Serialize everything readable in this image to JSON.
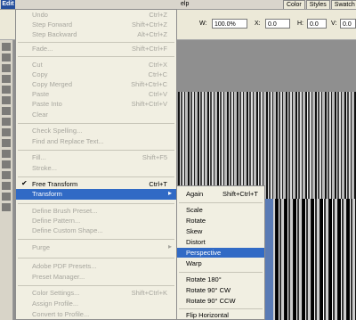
{
  "menubar": {
    "edit": "Edit",
    "help": "elp",
    "tabs": [
      "Color",
      "Styles",
      "Swatch"
    ]
  },
  "options": {
    "w_label": "W:",
    "w_value": "100.0%",
    "x_label": "X:",
    "x_value": "0.0",
    "h_label": "H:",
    "h_value": "0.0",
    "v_label": "V:",
    "v_value": "0.0"
  },
  "edit_menu": {
    "undo": {
      "label": "Undo",
      "shortcut": "Ctrl+Z"
    },
    "step_forward": {
      "label": "Step Forward",
      "shortcut": "Shift+Ctrl+Z"
    },
    "step_backward": {
      "label": "Step Backward",
      "shortcut": "Alt+Ctrl+Z"
    },
    "fade": {
      "label": "Fade...",
      "shortcut": "Shift+Ctrl+F"
    },
    "cut": {
      "label": "Cut",
      "shortcut": "Ctrl+X"
    },
    "copy": {
      "label": "Copy",
      "shortcut": "Ctrl+C"
    },
    "copy_merged": {
      "label": "Copy Merged",
      "shortcut": "Shift+Ctrl+C"
    },
    "paste": {
      "label": "Paste",
      "shortcut": "Ctrl+V"
    },
    "paste_into": {
      "label": "Paste Into",
      "shortcut": "Shift+Ctrl+V"
    },
    "clear": {
      "label": "Clear"
    },
    "check_spelling": {
      "label": "Check Spelling..."
    },
    "find_replace": {
      "label": "Find and Replace Text..."
    },
    "fill": {
      "label": "Fill...",
      "shortcut": "Shift+F5"
    },
    "stroke": {
      "label": "Stroke..."
    },
    "free_transform": {
      "label": "Free Transform",
      "shortcut": "Ctrl+T",
      "check": "✔"
    },
    "transform": {
      "label": "Transform",
      "arrow": "▸"
    },
    "define_brush": {
      "label": "Define Brush Preset..."
    },
    "define_pattern": {
      "label": "Define Pattern..."
    },
    "define_shape": {
      "label": "Define Custom Shape..."
    },
    "purge": {
      "label": "Purge",
      "arrow": "▸"
    },
    "pdf_presets": {
      "label": "Adobe PDF Presets..."
    },
    "preset_manager": {
      "label": "Preset Manager..."
    },
    "color_settings": {
      "label": "Color Settings...",
      "shortcut": "Shift+Ctrl+K"
    },
    "assign_profile": {
      "label": "Assign Profile..."
    },
    "convert_profile": {
      "label": "Convert to Profile..."
    }
  },
  "transform_menu": {
    "again": {
      "label": "Again",
      "shortcut": "Shift+Ctrl+T"
    },
    "scale": "Scale",
    "rotate": "Rotate",
    "skew": "Skew",
    "distort": "Distort",
    "perspective": "Perspective",
    "warp": "Warp",
    "rotate_180": "Rotate 180°",
    "rotate_90_cw": "Rotate 90° CW",
    "rotate_90_ccw": "Rotate 90° CCW",
    "flip_horizontal": "Flip Horizontal"
  },
  "colors": {
    "highlight": "#316ac5",
    "menu_bg": "#f1efe2",
    "disabled": "#a7a69e"
  }
}
